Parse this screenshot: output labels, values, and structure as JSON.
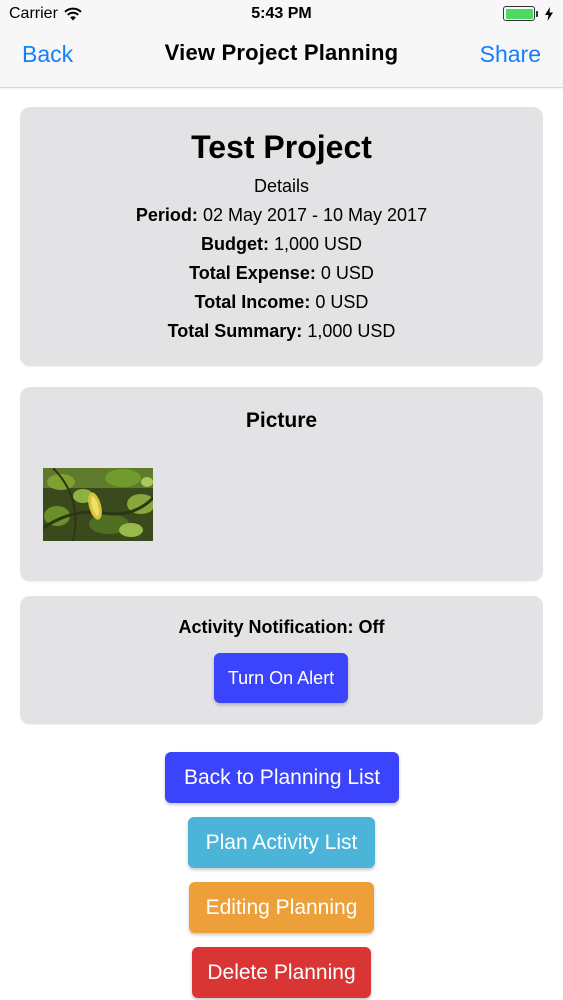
{
  "status_bar": {
    "carrier": "Carrier",
    "time": "5:43 PM"
  },
  "nav": {
    "back_label": "Back",
    "title": "View Project Planning",
    "share_label": "Share"
  },
  "project": {
    "title": "Test Project",
    "details_heading": "Details",
    "period_label": "Period:",
    "period_value": "02 May 2017 - 10 May 2017",
    "budget_label": "Budget:",
    "budget_value": "1,000 USD",
    "total_expense_label": "Total Expense:",
    "total_expense_value": "0 USD",
    "total_income_label": "Total Income:",
    "total_income_value": "0 USD",
    "total_summary_label": "Total Summary:",
    "total_summary_value": "1,000 USD"
  },
  "picture": {
    "heading": "Picture"
  },
  "activity": {
    "label": "Activity Notification:",
    "status": "Off",
    "alert_button": "Turn On Alert"
  },
  "actions": {
    "back_to_list": "Back to Planning List",
    "plan_activity_list": "Plan Activity List",
    "editing_planning": "Editing Planning",
    "delete_planning": "Delete Planning"
  },
  "colors": {
    "accent_blue": "#157efb",
    "button_blue": "#3b44fa",
    "button_cyan": "#4bb4d8",
    "button_orange": "#eda03a",
    "button_red": "#d93535",
    "battery_green": "#4cd964",
    "card_bg": "#e3e3e6"
  },
  "icons": {
    "wifi": "wifi-icon",
    "battery": "battery-icon",
    "charging": "bolt-icon"
  }
}
